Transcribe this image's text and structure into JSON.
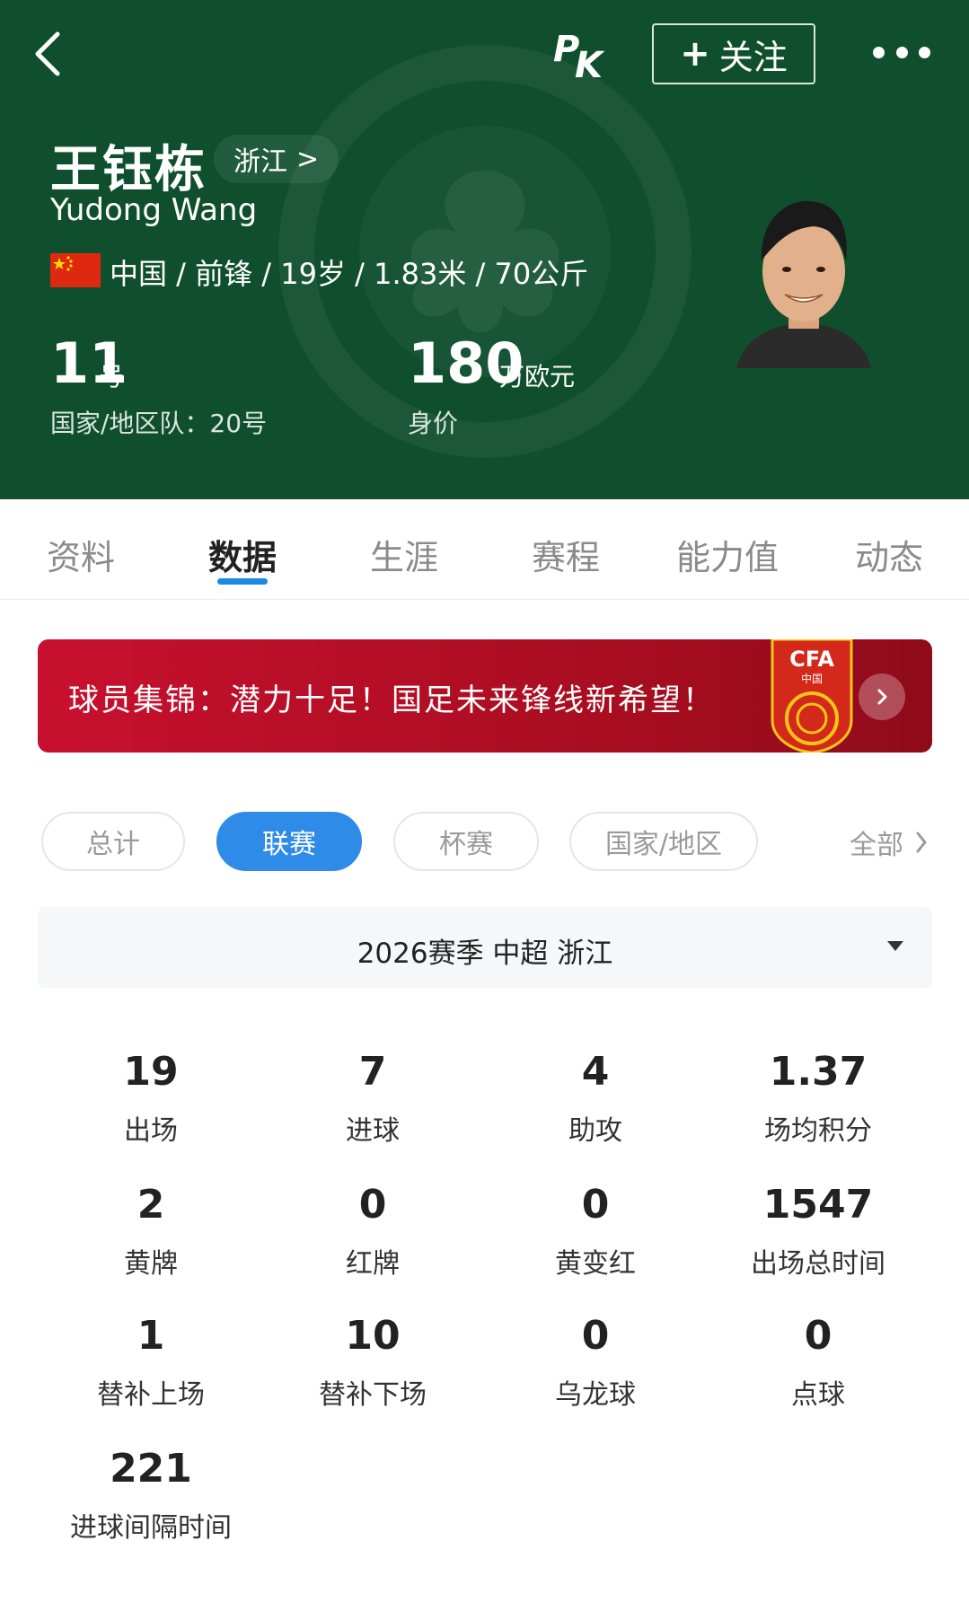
{
  "header": {
    "follow_label": "关注",
    "name_cn": "王钰栋",
    "team": "浙江",
    "team_chevron": ">",
    "name_en": "Yudong Wang",
    "bio": "中国 / 前锋 / 19岁 / 1.83米 / 70公斤",
    "shirt_number": "11",
    "shirt_unit": "号",
    "national_number": "国家/地区队：20号",
    "market_value": "180",
    "market_unit": "万欧元",
    "market_label": "身价"
  },
  "tabs": [
    "资料",
    "数据",
    "生涯",
    "赛程",
    "能力值",
    "动态"
  ],
  "active_tab": "数据",
  "banner": {
    "text": "球员集锦：潜力十足！国足未来锋线新希望！",
    "logo_text": "CFA",
    "logo_subtext": "中国"
  },
  "filters": [
    "总计",
    "联赛",
    "杯赛",
    "国家/地区"
  ],
  "active_filter": "联赛",
  "filter_all": "全部",
  "season": "2026赛季 中超 浙江",
  "stats": [
    {
      "value": "19",
      "label": "出场"
    },
    {
      "value": "7",
      "label": "进球"
    },
    {
      "value": "4",
      "label": "助攻"
    },
    {
      "value": "1.37",
      "label": "场均积分"
    },
    {
      "value": "2",
      "label": "黄牌"
    },
    {
      "value": "0",
      "label": "红牌"
    },
    {
      "value": "0",
      "label": "黄变红"
    },
    {
      "value": "1547",
      "label": "出场总时间"
    },
    {
      "value": "1",
      "label": "替补上场"
    },
    {
      "value": "10",
      "label": "替补下场"
    },
    {
      "value": "0",
      "label": "乌龙球"
    },
    {
      "value": "0",
      "label": "点球"
    },
    {
      "value": "221",
      "label": "进球间隔时间"
    }
  ],
  "colors": {
    "header_bg": "#0f4f2e",
    "accent": "#2f8be8",
    "banner_red": "#c8102e"
  }
}
